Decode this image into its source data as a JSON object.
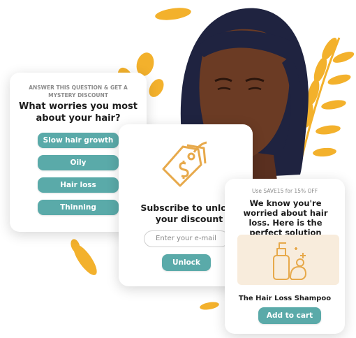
{
  "quiz": {
    "eyebrow": "ANSWER THIS QUESTION & GET A MYSTERY DISCOUNT",
    "title": "What worries you most about your hair?",
    "options": [
      "Slow hair growth",
      "Oily",
      "Hair loss",
      "Thinning"
    ]
  },
  "subscribe": {
    "title": "Subscribe to unlock your discount",
    "email_placeholder": "Enter your e-mail",
    "button": "Unlock"
  },
  "offer": {
    "eyebrow": "Use SAVE15 for 15% OFF",
    "title": "We know you're worried about hair loss. Here is the perfect solution",
    "product_name": "The Hair Loss Shampoo",
    "button": "Add to cart"
  },
  "colors": {
    "accent": "#5aaaa9",
    "leaf": "#f3b12c",
    "hair": "#1f2340",
    "skin": "#6b3b24",
    "tag_icon": "#e7a94b"
  }
}
